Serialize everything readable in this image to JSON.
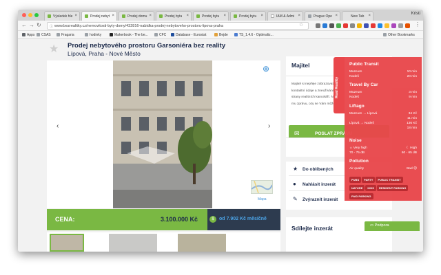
{
  "browser": {
    "tabs": [
      {
        "label": "Výsledek hle",
        "favicon": "green-leaf-icon",
        "color": "#7ab843"
      },
      {
        "label": "Prodej nebyt",
        "favicon": "green-leaf-icon",
        "color": "#7ab843"
      },
      {
        "label": "Prodej domu",
        "favicon": "green-leaf-icon",
        "color": "#7ab843"
      },
      {
        "label": "Prodej bytu",
        "favicon": "green-leaf-icon",
        "color": "#7ab843"
      },
      {
        "label": "Prodej bytu",
        "favicon": "green-leaf-icon",
        "color": "#7ab843"
      },
      {
        "label": "Prodej bytu",
        "favicon": "green-leaf-icon",
        "color": "#7ab843"
      },
      {
        "label": "IAM & Admi",
        "favicon": "google-icon",
        "color": "#ffffff"
      },
      {
        "label": "Prague Ope",
        "favicon": "doc-icon",
        "color": "#9aa0a6"
      },
      {
        "label": "New Tab",
        "favicon": "",
        "color": ""
      }
    ],
    "active_tab_index": 1,
    "profile": "Kristi",
    "url": "www.bezrealitky.cz/nemovitosti-byty-domy/432816-nabidka-prodej-nebytoveho-prostoru-lipova-praha",
    "bookmarks": [
      {
        "label": "Apps",
        "icon": "apps-grid-icon",
        "color": "#5f6368"
      },
      {
        "label": "CSAS",
        "icon": "folder-icon",
        "color": "#9aa0a6"
      },
      {
        "label": "Fragaria",
        "icon": "folder-icon",
        "color": "#9aa0a6"
      },
      {
        "label": "hodinky",
        "icon": "folder-icon",
        "color": "#9aa0a6"
      },
      {
        "label": "Makerbook - The be...",
        "icon": "makerbook-icon",
        "color": "#222222"
      },
      {
        "label": "CFC",
        "icon": "doc-icon",
        "color": "#9aa0a6"
      },
      {
        "label": "Database - Eurostat",
        "icon": "eurostat-icon",
        "color": "#1f4e9c"
      },
      {
        "label": "Bejde",
        "icon": "bejde-icon",
        "color": "#e2a13a"
      },
      {
        "label": "TS_1.4.6 - Optimaliz...",
        "icon": "ts-icon",
        "color": "#4a7bd0"
      }
    ],
    "other_bookmarks": "Other Bookmarks"
  },
  "listing": {
    "title": "Prodej nebytového prostoru Garsoniéra bez reality",
    "location": "Lípová, Praha - Nové Město",
    "map_label": "Mapa",
    "price_label": "CENA:",
    "price_value": "3.100.000 Kč",
    "monthly": "od 7.902 Kč měsíčně"
  },
  "owner": {
    "heading": "Majitel",
    "text": "Majitel si nepřeje zobrazovat své kontaktní údaje a zneužívání ze strany realitních kanceláří. Napište mu zprávu, ozy se Vám může.",
    "send_label": "POSLAT ZPRÁVU"
  },
  "actions": [
    {
      "label": "Do oblíbených",
      "icon": "star-icon"
    },
    {
      "label": "Nahlásit inzerát",
      "icon": "alert-icon"
    },
    {
      "label": "Zvýraznit inzerát",
      "icon": "pencil-icon"
    }
  ],
  "share_heading": "Sdílejte inzerát",
  "support_label": "Podpora",
  "real_reality": {
    "tab_label": "Real Reality",
    "public_transit": {
      "heading": "Public Transit",
      "rows": [
        {
          "place": "Muzeum",
          "time": "10 min"
        },
        {
          "place": "Nodeš",
          "time": "20 min"
        }
      ]
    },
    "car": {
      "heading": "Travel By Car",
      "rows": [
        {
          "place": "Muzeum",
          "time": "3 min"
        },
        {
          "place": "Nodeš",
          "time": "9 min"
        }
      ]
    },
    "liftago": {
      "heading": "Liftago",
      "rows": [
        {
          "place": "Muzeum → Lípová",
          "value": "34 Kč"
        },
        {
          "place": "",
          "value": "11 min"
        },
        {
          "place": "Lípová → Nodeš",
          "value": "136 Kč"
        },
        {
          "place": "",
          "value": "18 min"
        }
      ]
    },
    "noise": {
      "heading": "Noise",
      "day": "Very high",
      "day_range": "70 - 75 dB",
      "night": "High",
      "night_range": "60 - 65 dB"
    },
    "pollution": {
      "heading": "Pollution",
      "label": "Air quality",
      "value": "Bad"
    },
    "tags": [
      "PUBS",
      "PARTY",
      "PUBLIC TRANSIT",
      "NATURE",
      "KIDS",
      "RESIDENT PARKING",
      "PAID PARKING"
    ]
  }
}
